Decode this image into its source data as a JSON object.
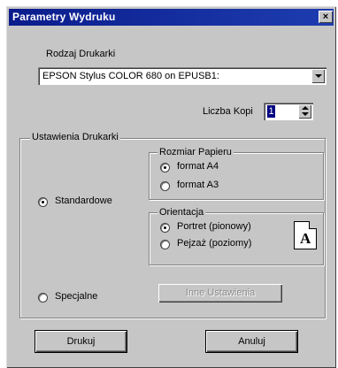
{
  "dialog": {
    "title": "Parametry Wydruku",
    "close_label": "×"
  },
  "printer": {
    "label": "Rodzaj Drukarki",
    "selected": "EPSON Stylus COLOR 680 on EPUSB1:"
  },
  "copies": {
    "label": "Liczba Kopi",
    "value": "1"
  },
  "settings": {
    "group_label": "Ustawienia Drukarki",
    "mode_standard": "Standardowe",
    "mode_special": "Specjalne",
    "selected_mode": "Standardowe",
    "other_settings_button": "Inne Ustawienia"
  },
  "paper": {
    "group_label": "Rozmiar Papieru",
    "options": [
      "format A4",
      "format A3"
    ],
    "selected": "format A4"
  },
  "orientation": {
    "group_label": "Orientacja",
    "options": [
      "Portret (pionowy)",
      "Pejzaż (poziomy)"
    ],
    "selected": "Portret (pionowy)",
    "preview_letter": "A"
  },
  "buttons": {
    "print": "Drukuj",
    "cancel": "Anuluj"
  },
  "colors": {
    "titlebar": "#0a1c8c",
    "face": "#c6c6c6",
    "selection": "#000080"
  }
}
